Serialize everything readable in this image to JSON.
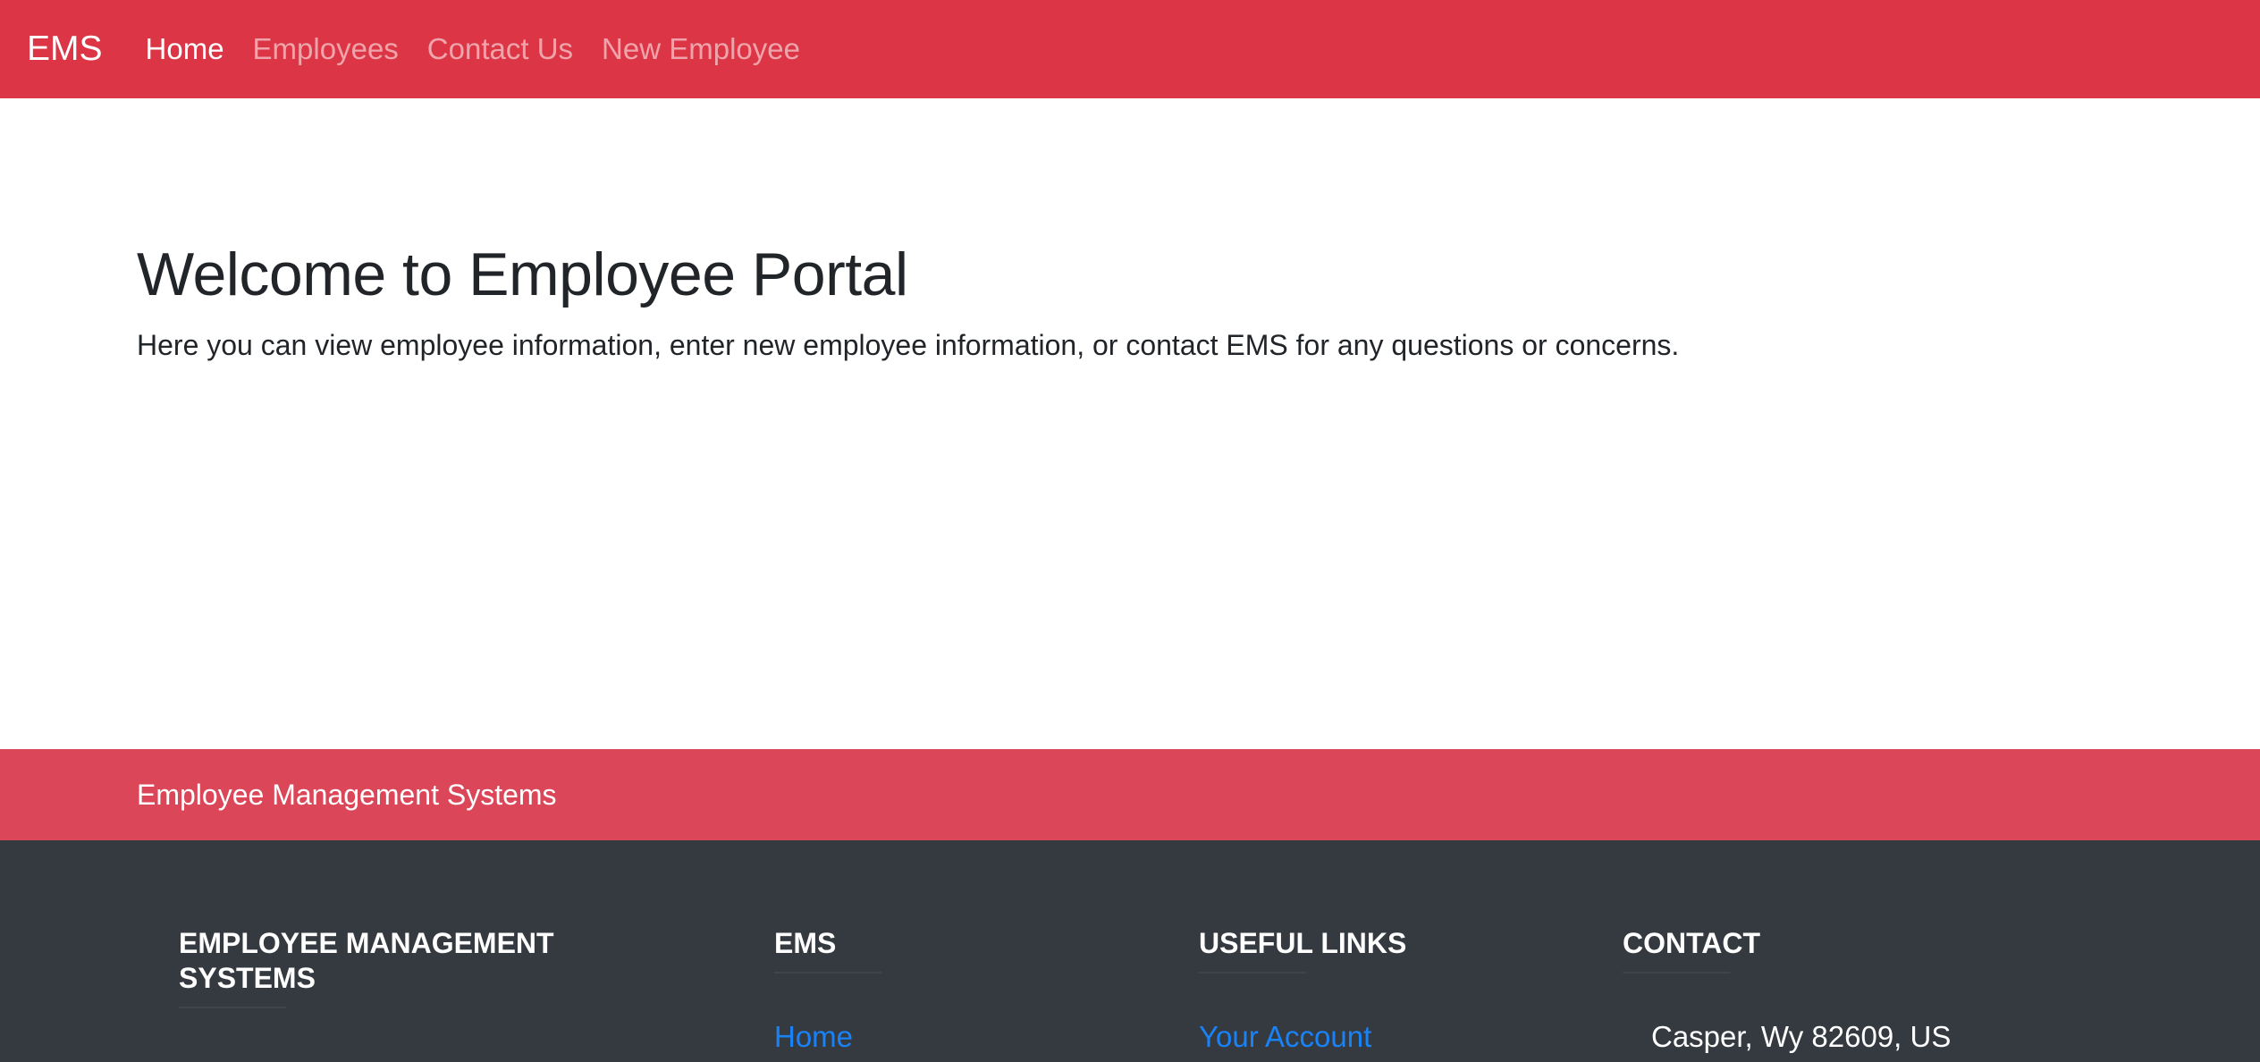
{
  "navbar": {
    "brand": "EMS",
    "links": [
      {
        "label": "Home",
        "active": true
      },
      {
        "label": "Employees",
        "active": false
      },
      {
        "label": "Contact Us",
        "active": false
      },
      {
        "label": "New Employee",
        "active": false
      }
    ]
  },
  "hero": {
    "title": "Welcome to Employee Portal",
    "subtitle": "Here you can view employee information, enter new employee information, or contact EMS for any questions or concerns."
  },
  "footer_band": {
    "text": "Employee Management Systems"
  },
  "footer": {
    "columns": [
      {
        "heading": "EMPLOYEE MANAGEMENT SYSTEMS"
      },
      {
        "heading": "EMS",
        "links": [
          "Home"
        ]
      },
      {
        "heading": "USEFUL LINKS",
        "links": [
          "Your Account"
        ]
      },
      {
        "heading": "CONTACT",
        "lines": [
          "Casper, Wy 82609, US"
        ]
      }
    ]
  },
  "colors": {
    "navbar": "#dc3545",
    "footer_band": "#db4658",
    "footer_dark": "#343a40",
    "link": "#1a82f7"
  }
}
